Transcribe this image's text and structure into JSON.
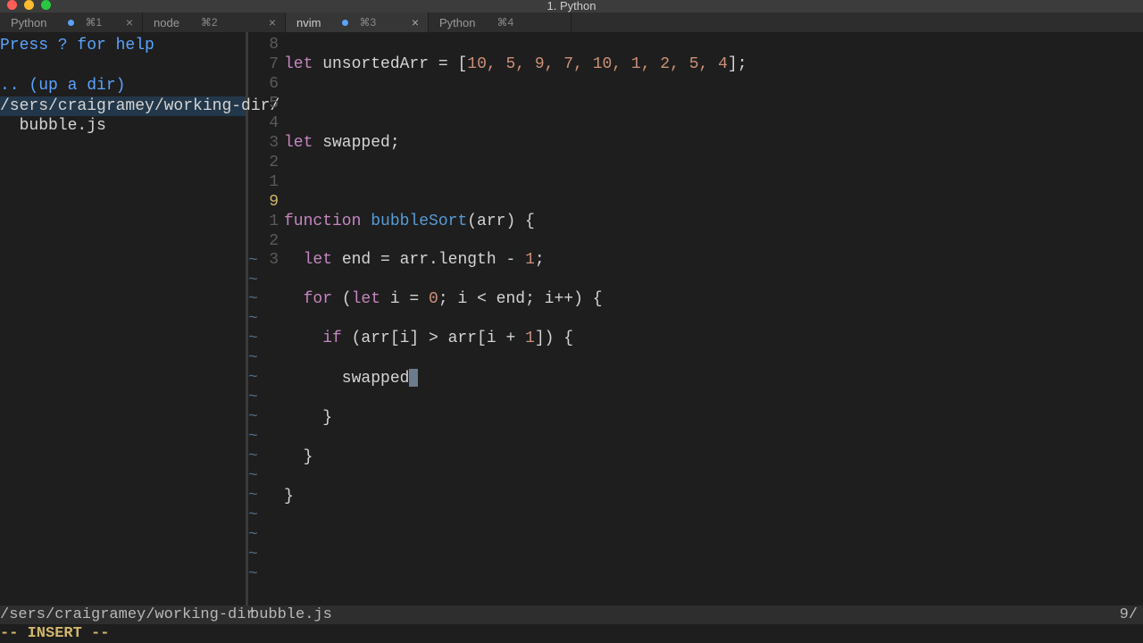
{
  "window": {
    "title": "1. Python",
    "traffic_lights": {
      "close": "#ff5f57",
      "min": "#febc2e",
      "max": "#28c840"
    }
  },
  "tabs": [
    {
      "label": "Python",
      "shortcut": "⌘1",
      "active": false,
      "dot": true
    },
    {
      "label": "node",
      "shortcut": "⌘2",
      "active": false,
      "dot": false
    },
    {
      "label": "nvim",
      "shortcut": "⌘3",
      "active": true,
      "dot": true
    },
    {
      "label": "Python",
      "shortcut": "⌘4",
      "active": false,
      "dot": false
    }
  ],
  "sidebar": {
    "help": "Press ? for help",
    "updir": ".. (up a dir)",
    "path": "/sers/craigramey/working-dir/",
    "file": "  bubble.js"
  },
  "gutter": [
    "8",
    "7",
    "6",
    "5",
    "4",
    "3",
    "2",
    "1",
    "9",
    "1",
    "2",
    "3"
  ],
  "gutter_current_index": 8,
  "code": {
    "l0_kw": "let",
    "l0_id": " unsortedArr ",
    "l0_op": "=",
    "l0_br": " [",
    "l0_nums": "10, 5, 9, 7, 10, 1, 2, 5, 4",
    "l0_end": "];",
    "l1": "",
    "l2_kw": "let",
    "l2_id": " swapped;",
    "l3": "",
    "l4_kw": "function",
    "l4_fn": " bubbleSort",
    "l4_rest": "(arr) {",
    "l5_kw": "  let",
    "l5_rest": " end = arr.length - ",
    "l5_num": "1",
    "l5_end": ";",
    "l6_kw": "  for",
    "l6_a": " (",
    "l6_let": "let",
    "l6_b": " i = ",
    "l6_n0": "0",
    "l6_c": "; i < end; i++) {",
    "l7_kw": "    if",
    "l7_a": " (arr[i] > arr[i + ",
    "l7_n1": "1",
    "l7_b": "]) {",
    "l8": "      swapped",
    "l9": "    }",
    "l10": "  }",
    "l11": "}"
  },
  "tildes": [
    "~",
    "~",
    "~",
    "~",
    "~",
    "~",
    "~",
    "~",
    "~",
    "~",
    "~",
    "~",
    "~",
    "~",
    "~",
    "~",
    "~"
  ],
  "status": {
    "left": "/sers/craigramey/working-dir ",
    "mid": "bubble.js",
    "right": "9/"
  },
  "mode": "-- INSERT --"
}
